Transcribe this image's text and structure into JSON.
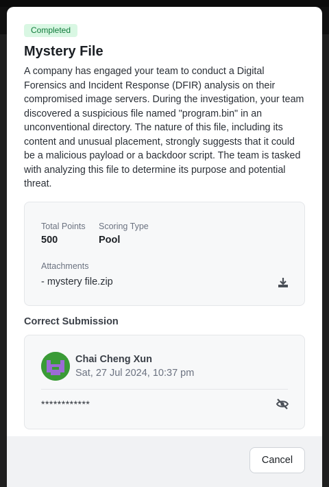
{
  "challenge": {
    "status_badge": "Completed",
    "title": "Mystery File",
    "description": "A company has engaged your team to conduct a Digital Forensics and Incident Response (DFIR) analysis on their compromised image servers. During the investigation, your team discovered a suspicious file named \"program.bin\" in an unconventional directory. The nature of this file, including its content and unusual placement, strongly suggests that it could be a malicious payload or a backdoor script. The team is tasked with analyzing this file to determine its purpose and potential threat."
  },
  "info": {
    "total_points_label": "Total Points",
    "total_points_value": "500",
    "scoring_type_label": "Scoring Type",
    "scoring_type_value": "Pool",
    "attachments_label": "Attachments",
    "attachment_file": "- mystery file.zip",
    "download_icon": "download-icon"
  },
  "submission": {
    "section_title": "Correct Submission",
    "user_name": "Chai Cheng Xun",
    "timestamp": "Sat, 27 Jul 2024, 10:37 pm",
    "masked_flag": "************",
    "reveal_icon": "eye-off-icon",
    "avatar_color": "#3a9b37",
    "avatar_accent": "#9b6bd6"
  },
  "footer": {
    "cancel_label": "Cancel"
  },
  "colors": {
    "badge_bg": "#d9f7e3",
    "badge_text": "#0f7a3a"
  }
}
